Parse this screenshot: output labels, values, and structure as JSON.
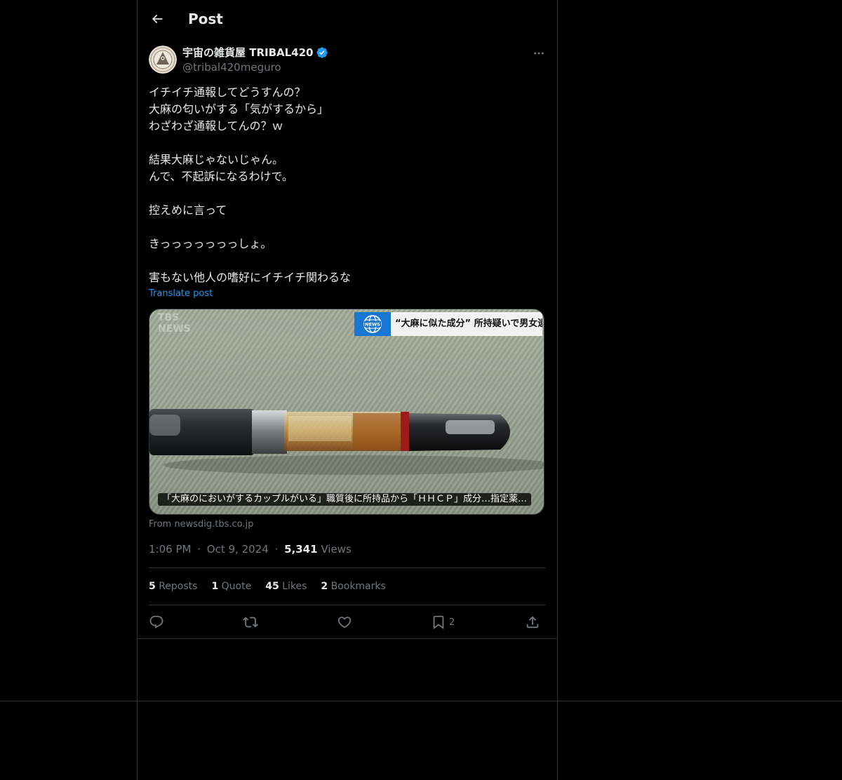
{
  "header": {
    "title": "Post"
  },
  "author": {
    "name": "宇宙の雑貨屋 TRIBAL420",
    "handle": "@tribal420meguro",
    "verified": true,
    "verified_color": "#1d9bf0"
  },
  "post": {
    "lines": [
      "イチイチ通報してどうすんの？",
      "大麻の匂いがする「気がするから」",
      "わざわざ通報してんの？ｗ",
      "",
      "結果大麻じゃないじゃん。",
      "んで、不起訴になるわけで。",
      "",
      "控えめに言って",
      "",
      "きっっっっっっっしょ。",
      "",
      "害もない他人の嗜好にイチイチ関わるな"
    ],
    "translate_label": "Translate post"
  },
  "media": {
    "watermark_top": "TBS",
    "watermark_bottom": "NEWS",
    "logo_label": "NEWS",
    "headline": "“大麻に似た成分” 所持疑いで男女逮捕",
    "caption": "「大麻のにおいがするカップルがいる」職質後に所持品から「ＨＨＣＰ」成分…指定薬…",
    "source": "From newsdig.tbs.co.jp"
  },
  "meta": {
    "time": "1:06 PM",
    "date": "Oct 9, 2024",
    "views_count": "5,341",
    "views_label": "Views",
    "separator": "·"
  },
  "stats": {
    "reposts_count": "5",
    "reposts_label": "Reposts",
    "quotes_count": "1",
    "quotes_label": "Quote",
    "likes_count": "45",
    "likes_label": "Likes",
    "bookmarks_count": "2",
    "bookmarks_label": "Bookmarks"
  },
  "actions": {
    "reply_icon": "reply-icon",
    "repost_icon": "repost-icon",
    "like_icon": "heart-icon",
    "bookmark_icon": "bookmark-icon",
    "bookmark_count": "2",
    "share_icon": "share-icon"
  },
  "colors": {
    "background": "#000000",
    "text": "#e7e9ea",
    "secondary": "#71767b",
    "accent": "#1d9bf0",
    "border": "#2f3336"
  }
}
